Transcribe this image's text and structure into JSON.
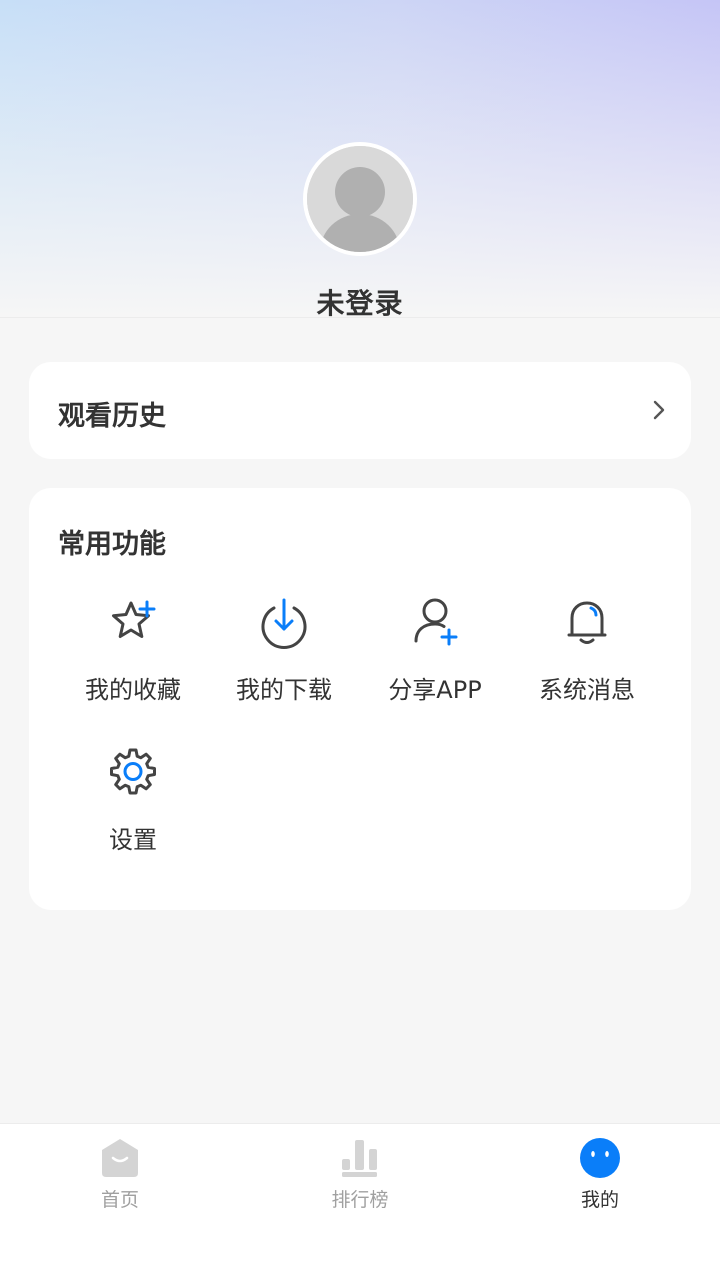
{
  "profile": {
    "username": "未登录",
    "avatar_icon": "default-avatar-icon"
  },
  "history": {
    "title": "观看历史",
    "icon": "chevron-right-icon"
  },
  "functions": {
    "title": "常用功能",
    "items": [
      {
        "label": "我的收藏",
        "icon": "star-plus-icon"
      },
      {
        "label": "我的下载",
        "icon": "download-icon"
      },
      {
        "label": "分享APP",
        "icon": "user-plus-icon"
      },
      {
        "label": "系统消息",
        "icon": "bell-icon"
      },
      {
        "label": "设置",
        "icon": "gear-icon"
      }
    ]
  },
  "tabbar": {
    "items": [
      {
        "label": "首页",
        "icon": "home-icon",
        "active": false
      },
      {
        "label": "排行榜",
        "icon": "ranking-icon",
        "active": false
      },
      {
        "label": "我的",
        "icon": "mine-icon",
        "active": true
      }
    ]
  },
  "colors": {
    "accent": "#0a7ef9",
    "icon_dark": "#444444",
    "tab_inactive": "#d4d4d4",
    "background": "#f6f6f6"
  }
}
